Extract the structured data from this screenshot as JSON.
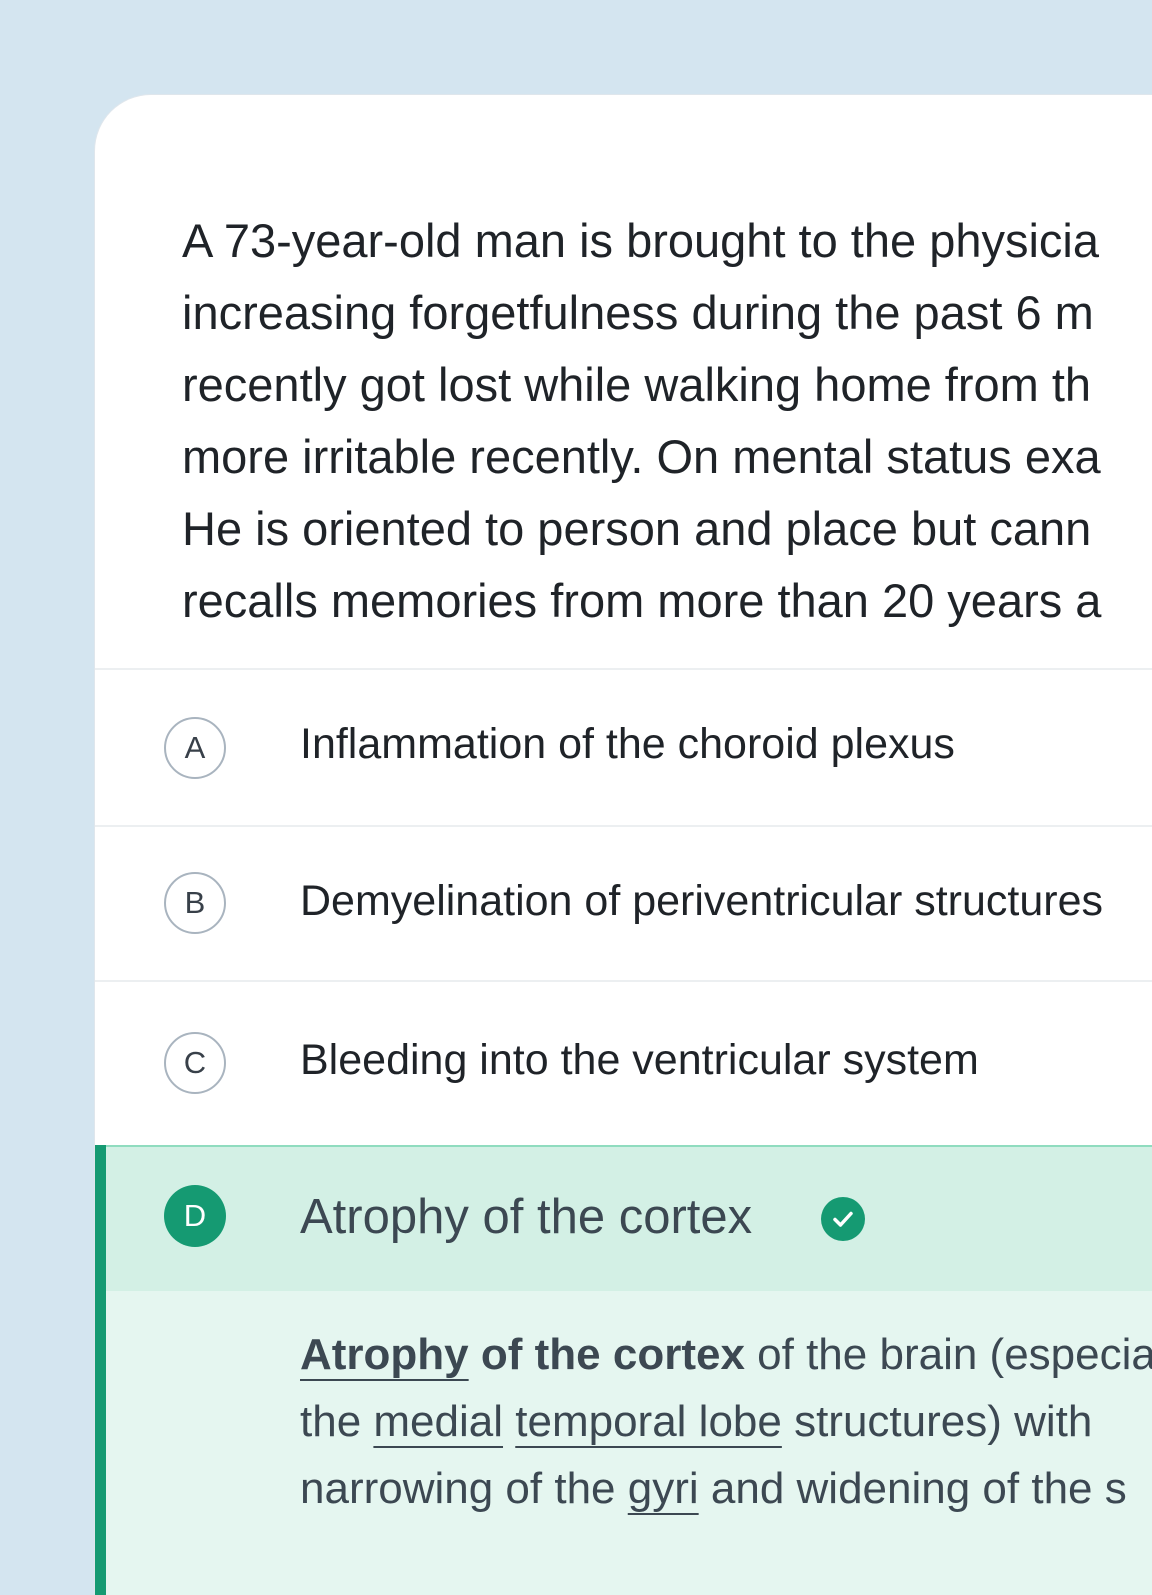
{
  "question": {
    "stem_lines": [
      "A 73-year-old man is brought to the physicia",
      "increasing forgetfulness during the past 6 m",
      "recently got lost while walking home from th",
      "more irritable recently. On mental status exa",
      "He is oriented to person and place but cann",
      "recalls memories from more than 20 years a"
    ]
  },
  "options": [
    {
      "letter": "A",
      "text": "Inflammation of the choroid plexus"
    },
    {
      "letter": "B",
      "text": "Demyelination of periventricular structures"
    },
    {
      "letter": "C",
      "text": "Bleeding into the ventricular system"
    },
    {
      "letter": "D",
      "text": "Atrophy of the cortex",
      "selected": true,
      "correct": true
    }
  ],
  "explanation": {
    "line1": {
      "term1": "Atrophy",
      "term2": " of the cortex",
      "rest": " of the brain (especial"
    },
    "line2": {
      "pre": "the ",
      "term1": "medial",
      "sep": " ",
      "term2": "temporal lobe",
      "post": " structures) with"
    },
    "line3": {
      "pre": "narrowing of the ",
      "term1": "gyri",
      "post": " and widening of the s"
    }
  },
  "colors": {
    "background": "#d4e5f0",
    "correct_accent": "#159a72",
    "selected_row": "#d3f0e5",
    "explanation_bg": "#e5f6f0"
  },
  "icons": {
    "correct": "check-circle-icon"
  }
}
